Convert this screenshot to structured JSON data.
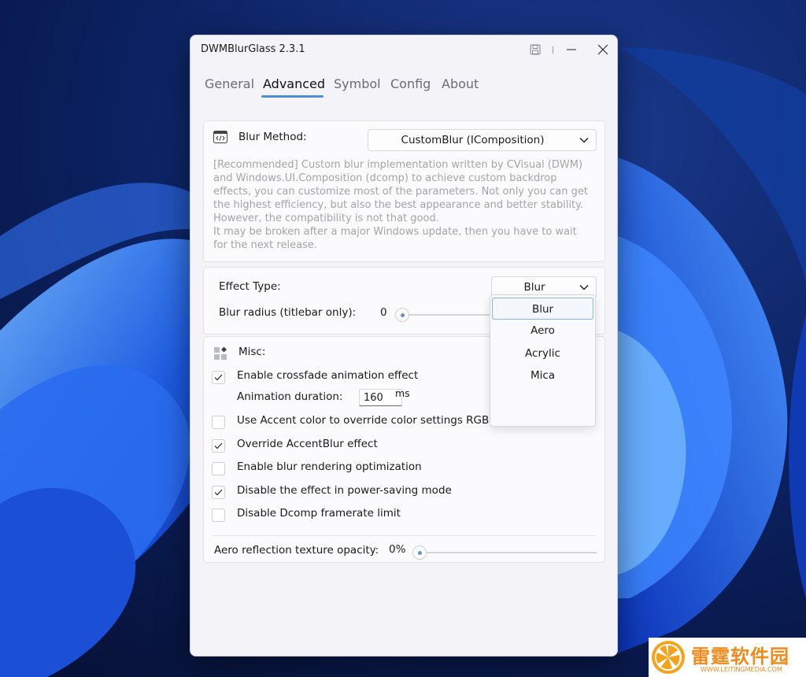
{
  "app": {
    "title": "DWMBlurGlass 2.3.1"
  },
  "tabs": [
    {
      "label": "General",
      "active": false
    },
    {
      "label": "Advanced",
      "active": true
    },
    {
      "label": "Symbol",
      "active": false
    },
    {
      "label": "Config",
      "active": false
    },
    {
      "label": "About",
      "active": false
    }
  ],
  "blur_method": {
    "label": "Blur Method:",
    "selected": "CustomBlur (IComposition)",
    "description": [
      "[Recommended] Custom blur implementation written by CVisual (DWM)",
      "and Windows.UI.Composition (dcomp) to achieve custom backdrop",
      "effects, you can customize most of the parameters. Not only you can get",
      "the highest efficiency, but also the best appearance and better stability.",
      "However, the compatibility is not that good.",
      "It may be broken after a major Windows update, then you have to wait",
      "for the next release."
    ]
  },
  "effect": {
    "type_label": "Effect Type:",
    "type_selected": "Blur",
    "radius_label": "Blur radius (titlebar only):",
    "radius_value": "0",
    "radius_fraction": 0.0
  },
  "dropdown": {
    "options": [
      "Blur",
      "Aero",
      "Acrylic",
      "Mica"
    ],
    "selected_index": 0
  },
  "misc": {
    "label": "Misc:",
    "crossfade": {
      "label": "Enable crossfade animation effect",
      "checked": true
    },
    "duration": {
      "label": "Animation duration:",
      "value": "160",
      "unit": "ms"
    },
    "accent": {
      "label": "Use Accent color to override color settings RGB",
      "checked": false
    },
    "override_accentblur": {
      "label": "Override AccentBlur effect",
      "checked": true
    },
    "blur_opt": {
      "label": "Enable blur rendering optimization",
      "checked": false
    },
    "power_saving": {
      "label": "Disable the effect in power-saving mode",
      "checked": true
    },
    "dcomp_limit": {
      "label": "Disable Dcomp framerate limit",
      "checked": false
    },
    "aero_opacity": {
      "label": "Aero reflection texture opacity:",
      "value": "0%",
      "fraction": 0.0
    }
  },
  "watermark": {
    "text": "雷霆软件园",
    "url": "WWW.LEITINGMEDIA.COM"
  },
  "colors": {
    "accent": "#4f8fd9",
    "window_bg": "#f4f3f7",
    "card_bg": "#fbfbfd",
    "desc_text": "#a3a3aa"
  },
  "icons": [
    "save-icon",
    "minimize-icon",
    "close-icon",
    "code-window-icon",
    "chevron-down-icon",
    "misc-grid-icon",
    "check-icon"
  ]
}
